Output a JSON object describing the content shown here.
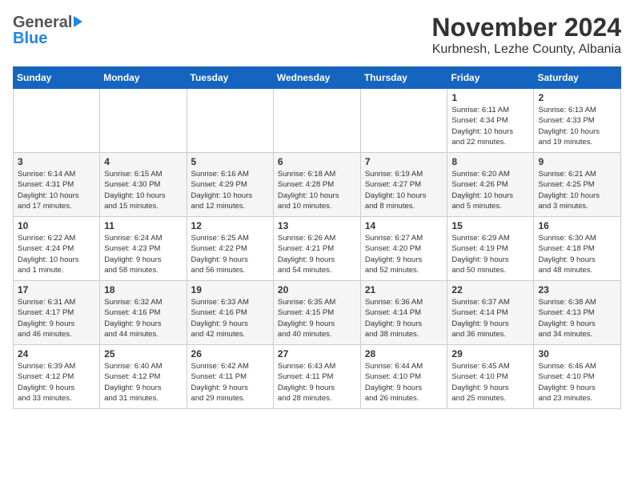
{
  "header": {
    "logo_general": "General",
    "logo_blue": "Blue",
    "month": "November 2024",
    "location": "Kurbnesh, Lezhe County, Albania"
  },
  "weekdays": [
    "Sunday",
    "Monday",
    "Tuesday",
    "Wednesday",
    "Thursday",
    "Friday",
    "Saturday"
  ],
  "weeks": [
    [
      {
        "day": "",
        "info": ""
      },
      {
        "day": "",
        "info": ""
      },
      {
        "day": "",
        "info": ""
      },
      {
        "day": "",
        "info": ""
      },
      {
        "day": "",
        "info": ""
      },
      {
        "day": "1",
        "info": "Sunrise: 6:11 AM\nSunset: 4:34 PM\nDaylight: 10 hours\nand 22 minutes."
      },
      {
        "day": "2",
        "info": "Sunrise: 6:13 AM\nSunset: 4:33 PM\nDaylight: 10 hours\nand 19 minutes."
      }
    ],
    [
      {
        "day": "3",
        "info": "Sunrise: 6:14 AM\nSunset: 4:31 PM\nDaylight: 10 hours\nand 17 minutes."
      },
      {
        "day": "4",
        "info": "Sunrise: 6:15 AM\nSunset: 4:30 PM\nDaylight: 10 hours\nand 15 minutes."
      },
      {
        "day": "5",
        "info": "Sunrise: 6:16 AM\nSunset: 4:29 PM\nDaylight: 10 hours\nand 12 minutes."
      },
      {
        "day": "6",
        "info": "Sunrise: 6:18 AM\nSunset: 4:28 PM\nDaylight: 10 hours\nand 10 minutes."
      },
      {
        "day": "7",
        "info": "Sunrise: 6:19 AM\nSunset: 4:27 PM\nDaylight: 10 hours\nand 8 minutes."
      },
      {
        "day": "8",
        "info": "Sunrise: 6:20 AM\nSunset: 4:26 PM\nDaylight: 10 hours\nand 5 minutes."
      },
      {
        "day": "9",
        "info": "Sunrise: 6:21 AM\nSunset: 4:25 PM\nDaylight: 10 hours\nand 3 minutes."
      }
    ],
    [
      {
        "day": "10",
        "info": "Sunrise: 6:22 AM\nSunset: 4:24 PM\nDaylight: 10 hours\nand 1 minute."
      },
      {
        "day": "11",
        "info": "Sunrise: 6:24 AM\nSunset: 4:23 PM\nDaylight: 9 hours\nand 58 minutes."
      },
      {
        "day": "12",
        "info": "Sunrise: 6:25 AM\nSunset: 4:22 PM\nDaylight: 9 hours\nand 56 minutes."
      },
      {
        "day": "13",
        "info": "Sunrise: 6:26 AM\nSunset: 4:21 PM\nDaylight: 9 hours\nand 54 minutes."
      },
      {
        "day": "14",
        "info": "Sunrise: 6:27 AM\nSunset: 4:20 PM\nDaylight: 9 hours\nand 52 minutes."
      },
      {
        "day": "15",
        "info": "Sunrise: 6:29 AM\nSunset: 4:19 PM\nDaylight: 9 hours\nand 50 minutes."
      },
      {
        "day": "16",
        "info": "Sunrise: 6:30 AM\nSunset: 4:18 PM\nDaylight: 9 hours\nand 48 minutes."
      }
    ],
    [
      {
        "day": "17",
        "info": "Sunrise: 6:31 AM\nSunset: 4:17 PM\nDaylight: 9 hours\nand 46 minutes."
      },
      {
        "day": "18",
        "info": "Sunrise: 6:32 AM\nSunset: 4:16 PM\nDaylight: 9 hours\nand 44 minutes."
      },
      {
        "day": "19",
        "info": "Sunrise: 6:33 AM\nSunset: 4:16 PM\nDaylight: 9 hours\nand 42 minutes."
      },
      {
        "day": "20",
        "info": "Sunrise: 6:35 AM\nSunset: 4:15 PM\nDaylight: 9 hours\nand 40 minutes."
      },
      {
        "day": "21",
        "info": "Sunrise: 6:36 AM\nSunset: 4:14 PM\nDaylight: 9 hours\nand 38 minutes."
      },
      {
        "day": "22",
        "info": "Sunrise: 6:37 AM\nSunset: 4:14 PM\nDaylight: 9 hours\nand 36 minutes."
      },
      {
        "day": "23",
        "info": "Sunrise: 6:38 AM\nSunset: 4:13 PM\nDaylight: 9 hours\nand 34 minutes."
      }
    ],
    [
      {
        "day": "24",
        "info": "Sunrise: 6:39 AM\nSunset: 4:12 PM\nDaylight: 9 hours\nand 33 minutes."
      },
      {
        "day": "25",
        "info": "Sunrise: 6:40 AM\nSunset: 4:12 PM\nDaylight: 9 hours\nand 31 minutes."
      },
      {
        "day": "26",
        "info": "Sunrise: 6:42 AM\nSunset: 4:11 PM\nDaylight: 9 hours\nand 29 minutes."
      },
      {
        "day": "27",
        "info": "Sunrise: 6:43 AM\nSunset: 4:11 PM\nDaylight: 9 hours\nand 28 minutes."
      },
      {
        "day": "28",
        "info": "Sunrise: 6:44 AM\nSunset: 4:10 PM\nDaylight: 9 hours\nand 26 minutes."
      },
      {
        "day": "29",
        "info": "Sunrise: 6:45 AM\nSunset: 4:10 PM\nDaylight: 9 hours\nand 25 minutes."
      },
      {
        "day": "30",
        "info": "Sunrise: 6:46 AM\nSunset: 4:10 PM\nDaylight: 9 hours\nand 23 minutes."
      }
    ]
  ]
}
